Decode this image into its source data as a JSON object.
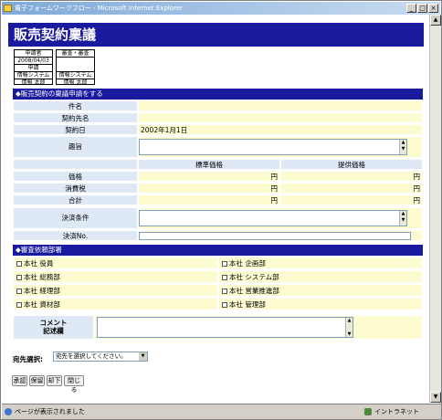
{
  "window": {
    "title": "電子フォームワークフロー - Microsoft Internet Explorer",
    "min": "_",
    "max": "□",
    "close": "×"
  },
  "page": {
    "title": "販売契約稟議"
  },
  "approval": {
    "col1": {
      "header": "申請者",
      "date": "2008/04/03",
      "action": "申請",
      "dept": "情報システム",
      "name": "情報 太郎"
    },
    "col2": {
      "header": "審査・審査",
      "dept": "情報システム",
      "name": "情報 太郎"
    }
  },
  "section1": {
    "title": "◆販売契約の稟議申請をする"
  },
  "fields": {
    "subject": "件名",
    "partner": "契約先名",
    "contract_date": "契約日",
    "contract_date_value": "2002年1月1日",
    "purpose": "趣旨",
    "std_price": "標準価格",
    "offer_price": "提供価格",
    "price": "価格",
    "tax": "消費税",
    "total": "合計",
    "yen": "円",
    "settle_cond": "決済条件",
    "settle_no": "決済No."
  },
  "section2": {
    "title": "◆審査依頼部署"
  },
  "depts": {
    "l1": "本社  役員",
    "r1": "本社  企画部",
    "l2": "本社  総務部",
    "r2": "本社  システム部",
    "l3": "本社  経理部",
    "r3": "本社  営業推進部",
    "l4": "本社  資材部",
    "r4": "本社  管理部"
  },
  "comment": {
    "label1": "コメント",
    "label2": "記述欄"
  },
  "dest": {
    "label": "宛先選択:",
    "placeholder": "宛先を選択してください。"
  },
  "buttons": {
    "approve": "承認",
    "hold": "保留",
    "reject": "却下",
    "close": "閉じる"
  },
  "status": {
    "left": "ページが表示されました",
    "zone": "イントラネット"
  }
}
